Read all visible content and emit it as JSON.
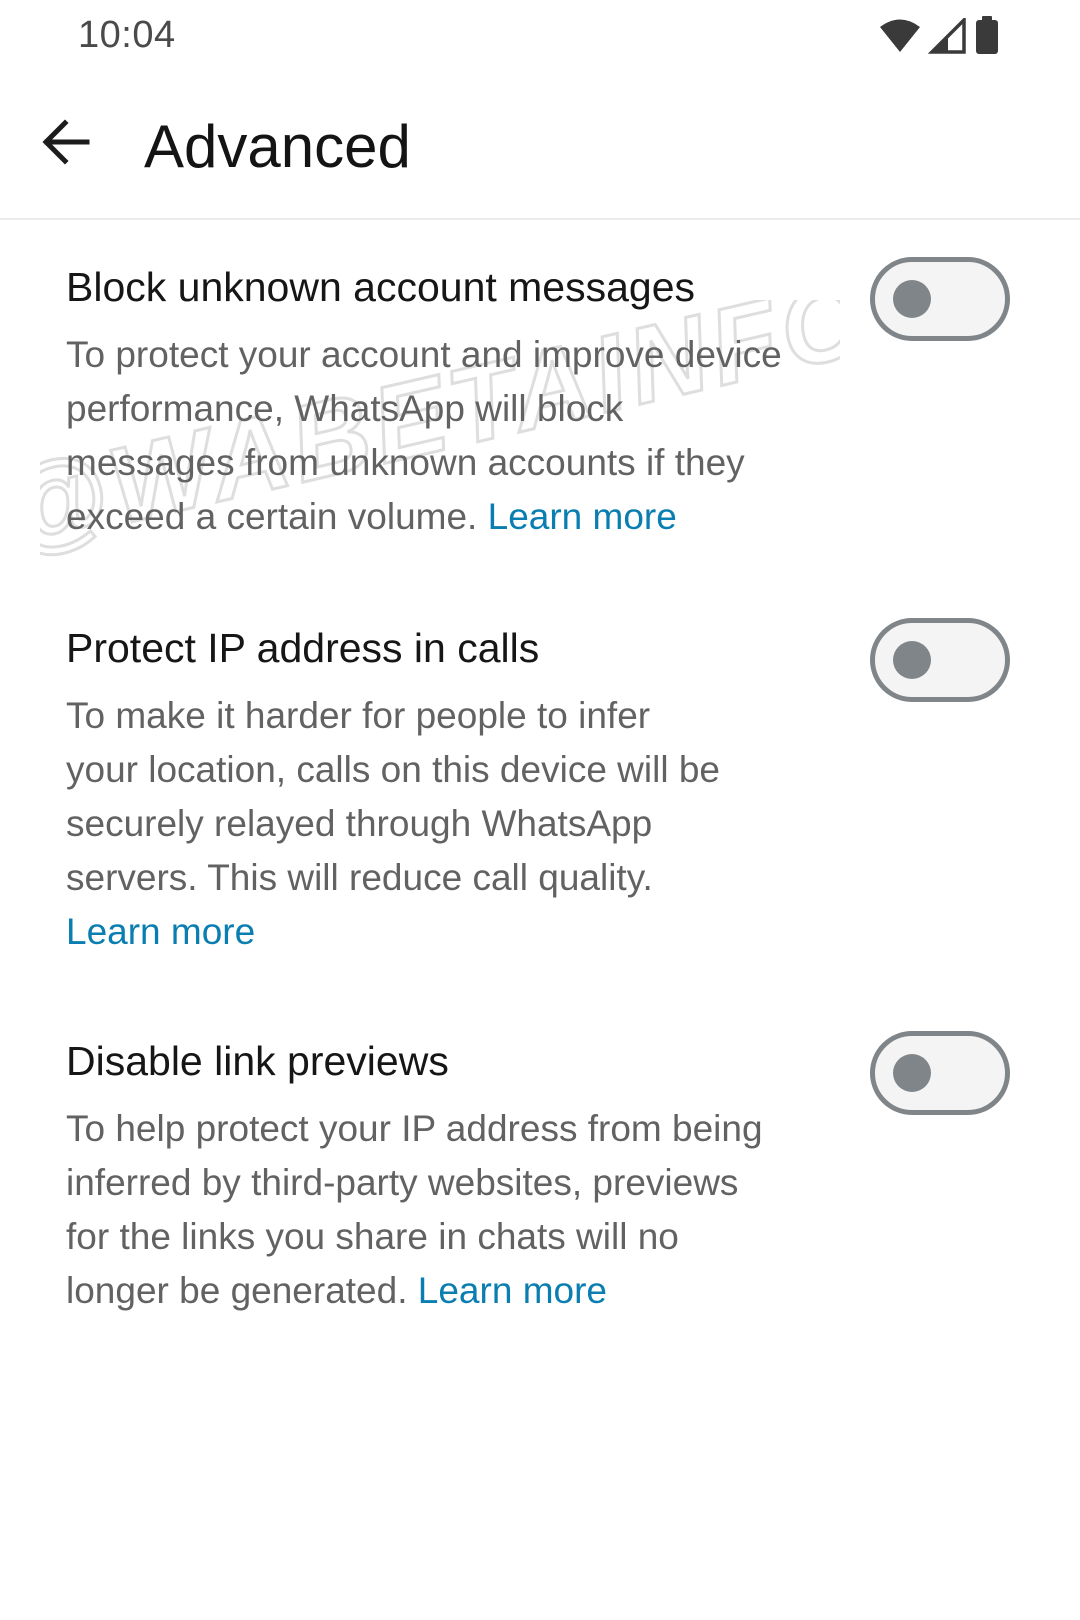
{
  "status_bar": {
    "time": "10:04",
    "icons": [
      "wifi-icon",
      "cell-signal-icon",
      "battery-icon"
    ]
  },
  "app_bar": {
    "back_icon": "arrow-left-icon",
    "title": "Advanced"
  },
  "settings": [
    {
      "title": "Block unknown account messages",
      "description": "To protect your account and improve device performance, WhatsApp will block messages from unknown accounts if they exceed a certain volume.",
      "link": "Learn more",
      "enabled": false
    },
    {
      "title": "Protect IP address in calls",
      "description": "To make it harder for people to infer your location, calls on this device will be securely relayed through WhatsApp servers. This will reduce call quality.",
      "link": "Learn more",
      "enabled": false
    },
    {
      "title": "Disable link previews",
      "description": "To help protect your IP address from being inferred by third-party websites, previews for the links you share in chats will no longer be generated.",
      "link": "Learn more",
      "enabled": false
    }
  ],
  "watermark": {
    "text": "@WABETAINFO"
  },
  "colors": {
    "link": "#0a7eb0",
    "toggle_off": "#7f8588",
    "title_text": "#161616",
    "desc_text": "#626262"
  }
}
